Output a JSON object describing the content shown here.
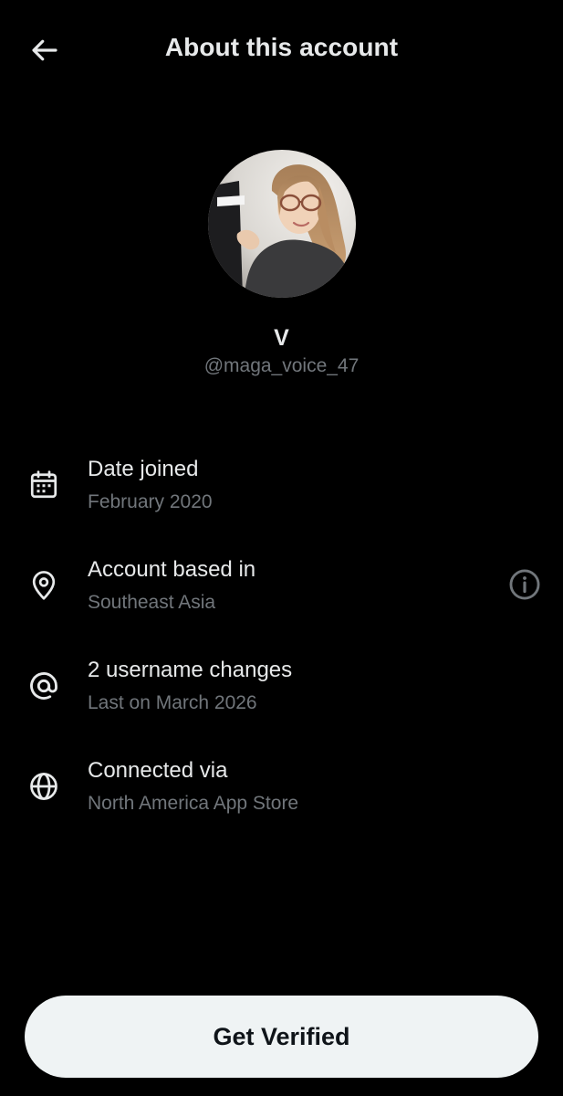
{
  "header": {
    "back_icon": "arrow-left-icon",
    "title": "About this account"
  },
  "profile": {
    "avatar_icon": "profile-photo",
    "display_name": "V",
    "handle": "@maga_voice_47"
  },
  "details": [
    {
      "icon": "calendar-icon",
      "label": "Date joined",
      "value": "February 2020"
    },
    {
      "icon": "location-pin-icon",
      "label": "Account based in",
      "value": "Southeast Asia",
      "trailing_icon": "info-icon"
    },
    {
      "icon": "at-sign-icon",
      "label": "2 username changes",
      "value": "Last on March 2026"
    },
    {
      "icon": "globe-icon",
      "label": "Connected via",
      "value": "North America App Store"
    }
  ],
  "cta": {
    "label": "Get Verified"
  },
  "colors": {
    "background": "#000000",
    "primary_text": "#e7e9ea",
    "secondary_text": "#71767b",
    "button_bg": "#eff3f4",
    "button_text": "#0f1419"
  }
}
